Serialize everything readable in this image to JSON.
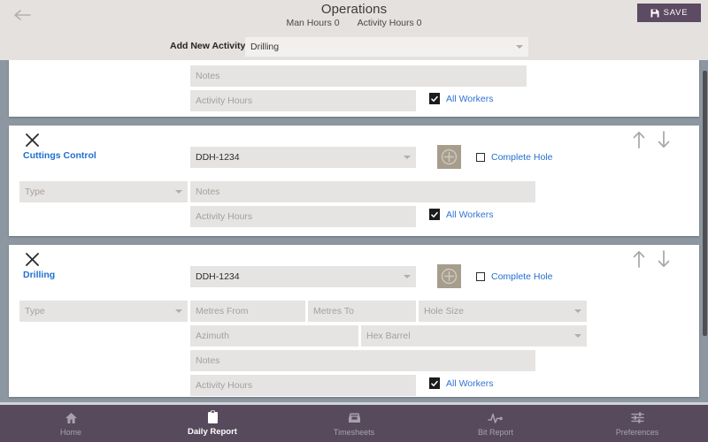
{
  "header": {
    "back_icon": "arrow-left-icon",
    "title": "Operations",
    "man_hours": "Man Hours 0",
    "activity_hours": "Activity Hours 0",
    "save_label": "SAVE",
    "save_icon": "save-disk-icon",
    "accent_purple": "#5d4a63",
    "background": "#e5e1de"
  },
  "add_activity": {
    "label": "Add New Activity",
    "selected": "Drilling",
    "caret_icon": "chevron-down-icon"
  },
  "cards": [
    {
      "id": "partial-card",
      "title": "",
      "fields": {
        "notes_placeholder": "Notes",
        "activity_hours_placeholder": "Activity Hours",
        "all_workers_label": "All Workers",
        "all_workers_checked": true
      }
    },
    {
      "id": "cuttings-control",
      "title": "Cuttings Control",
      "close_icon": "close-x-icon",
      "move_up_icon": "arrow-up-icon",
      "move_down_icon": "arrow-down-icon",
      "hole_value": "DDH-1234",
      "add_icon": "plus-circle-icon",
      "complete_hole_label": "Complete Hole",
      "complete_hole_checked": false,
      "type_placeholder": "Type",
      "notes_placeholder": "Notes",
      "activity_hours_placeholder": "Activity Hours",
      "all_workers_label": "All Workers",
      "all_workers_checked": true
    },
    {
      "id": "drilling",
      "title": "Drilling",
      "close_icon": "close-x-icon",
      "move_up_icon": "arrow-up-icon",
      "move_down_icon": "arrow-down-icon",
      "hole_value": "DDH-1234",
      "add_icon": "plus-circle-icon",
      "complete_hole_label": "Complete Hole",
      "complete_hole_checked": false,
      "type_placeholder": "Type",
      "metres_from_placeholder": "Metres From",
      "metres_to_placeholder": "Metres To",
      "hole_size_placeholder": "Hole Size",
      "azimuth_placeholder": "Azimuth",
      "hex_barrel_placeholder": "Hex Barrel",
      "notes_placeholder": "Notes",
      "activity_hours_placeholder": "Activity Hours",
      "all_workers_label": "All Workers",
      "all_workers_checked": true
    }
  ],
  "bottom_nav": {
    "items": [
      {
        "label": "Home",
        "icon": "home-icon",
        "active": false
      },
      {
        "label": "Daily Report",
        "icon": "clipboard-icon",
        "active": true
      },
      {
        "label": "Timesheets",
        "icon": "inbox-tray-icon",
        "active": false
      },
      {
        "label": "Bit Report",
        "icon": "pulse-wave-icon",
        "active": false
      },
      {
        "label": "Preferences",
        "icon": "sliders-icon",
        "active": false
      }
    ],
    "background": "#574a5c",
    "active_color": "#ffffff",
    "inactive_color": "#a9a0ad"
  },
  "colors": {
    "page_background": "#8d97a1",
    "card_background": "#ffffff",
    "field_background": "#e6e4e2",
    "link_blue": "#1f6fd0",
    "plus_button": "#a79d8c"
  }
}
